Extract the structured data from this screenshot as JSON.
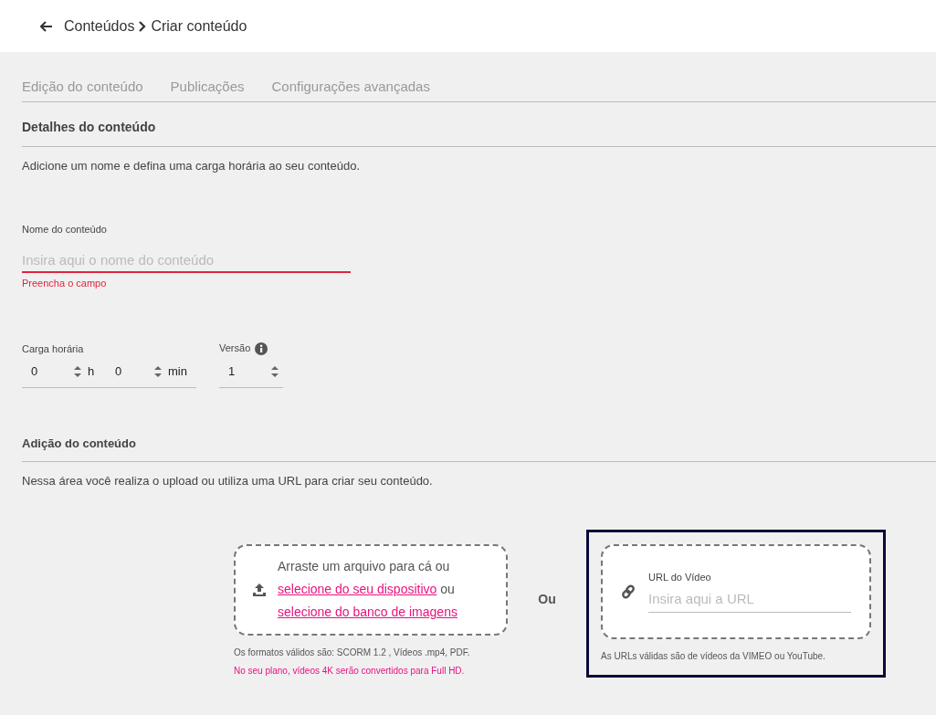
{
  "breadcrumb": {
    "parent": "Conteúdos",
    "current": "Criar conteúdo"
  },
  "tabs": [
    {
      "label": "Edição do conteúdo",
      "selected": false
    },
    {
      "label": "Publicações",
      "selected": false
    },
    {
      "label": "Configurações avançadas",
      "selected": false
    }
  ],
  "details": {
    "title": "Detalhes do conteúdo",
    "description": "Adicione um nome e defina uma carga horária ao seu conteúdo.",
    "name_field": {
      "label": "Nome do conteúdo",
      "placeholder": "Insira aqui o nome do conteúdo",
      "error": "Preencha o campo"
    },
    "workload": {
      "label": "Carga horária",
      "hours": "0",
      "hours_unit": "h",
      "minutes": "0",
      "minutes_unit": "min"
    },
    "version": {
      "label": "Versão",
      "value": "1"
    }
  },
  "addition": {
    "title": "Adição do conteúdo",
    "description": "Nessa área você realiza o upload ou utiliza uma URL para criar seu conteúdo.",
    "upload": {
      "text_1": "Arraste um arquivo para cá ou",
      "link_1": "selecione do seu dispositivo",
      "text_2": "ou",
      "link_2": "selecione do banco de imagens",
      "formats": "Os formatos válidos são: SCORM 1.2 , Vídeos .mp4, PDF.",
      "plan_note": "No seu plano, vídeos 4K serão convertidos para Full HD."
    },
    "separator": "Ou",
    "url": {
      "label": "URL do Vídeo",
      "placeholder": "Insira aqui a URL",
      "hint": "As URLs válidas são de vídeos da VIMEO ou YouTube.",
      "selected": true
    }
  }
}
